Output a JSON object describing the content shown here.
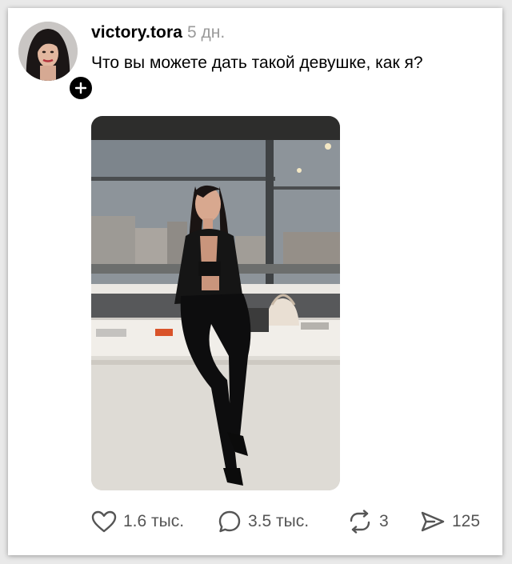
{
  "post": {
    "username": "victory.tora",
    "time": "5 дн.",
    "text": "Что вы можете дать такой девушке, как я?"
  },
  "icons": {
    "follow": "plus-icon",
    "like": "heart-icon",
    "comment": "comment-bubble-icon",
    "repost": "repost-icon",
    "share": "send-icon"
  },
  "actions": {
    "likes": "1.6 тыс.",
    "comments": "3.5 тыс.",
    "reposts": "3",
    "shares": "125"
  },
  "colors": {
    "text": "#000000",
    "muted": "#9a9a9a",
    "icon": "#555555"
  }
}
